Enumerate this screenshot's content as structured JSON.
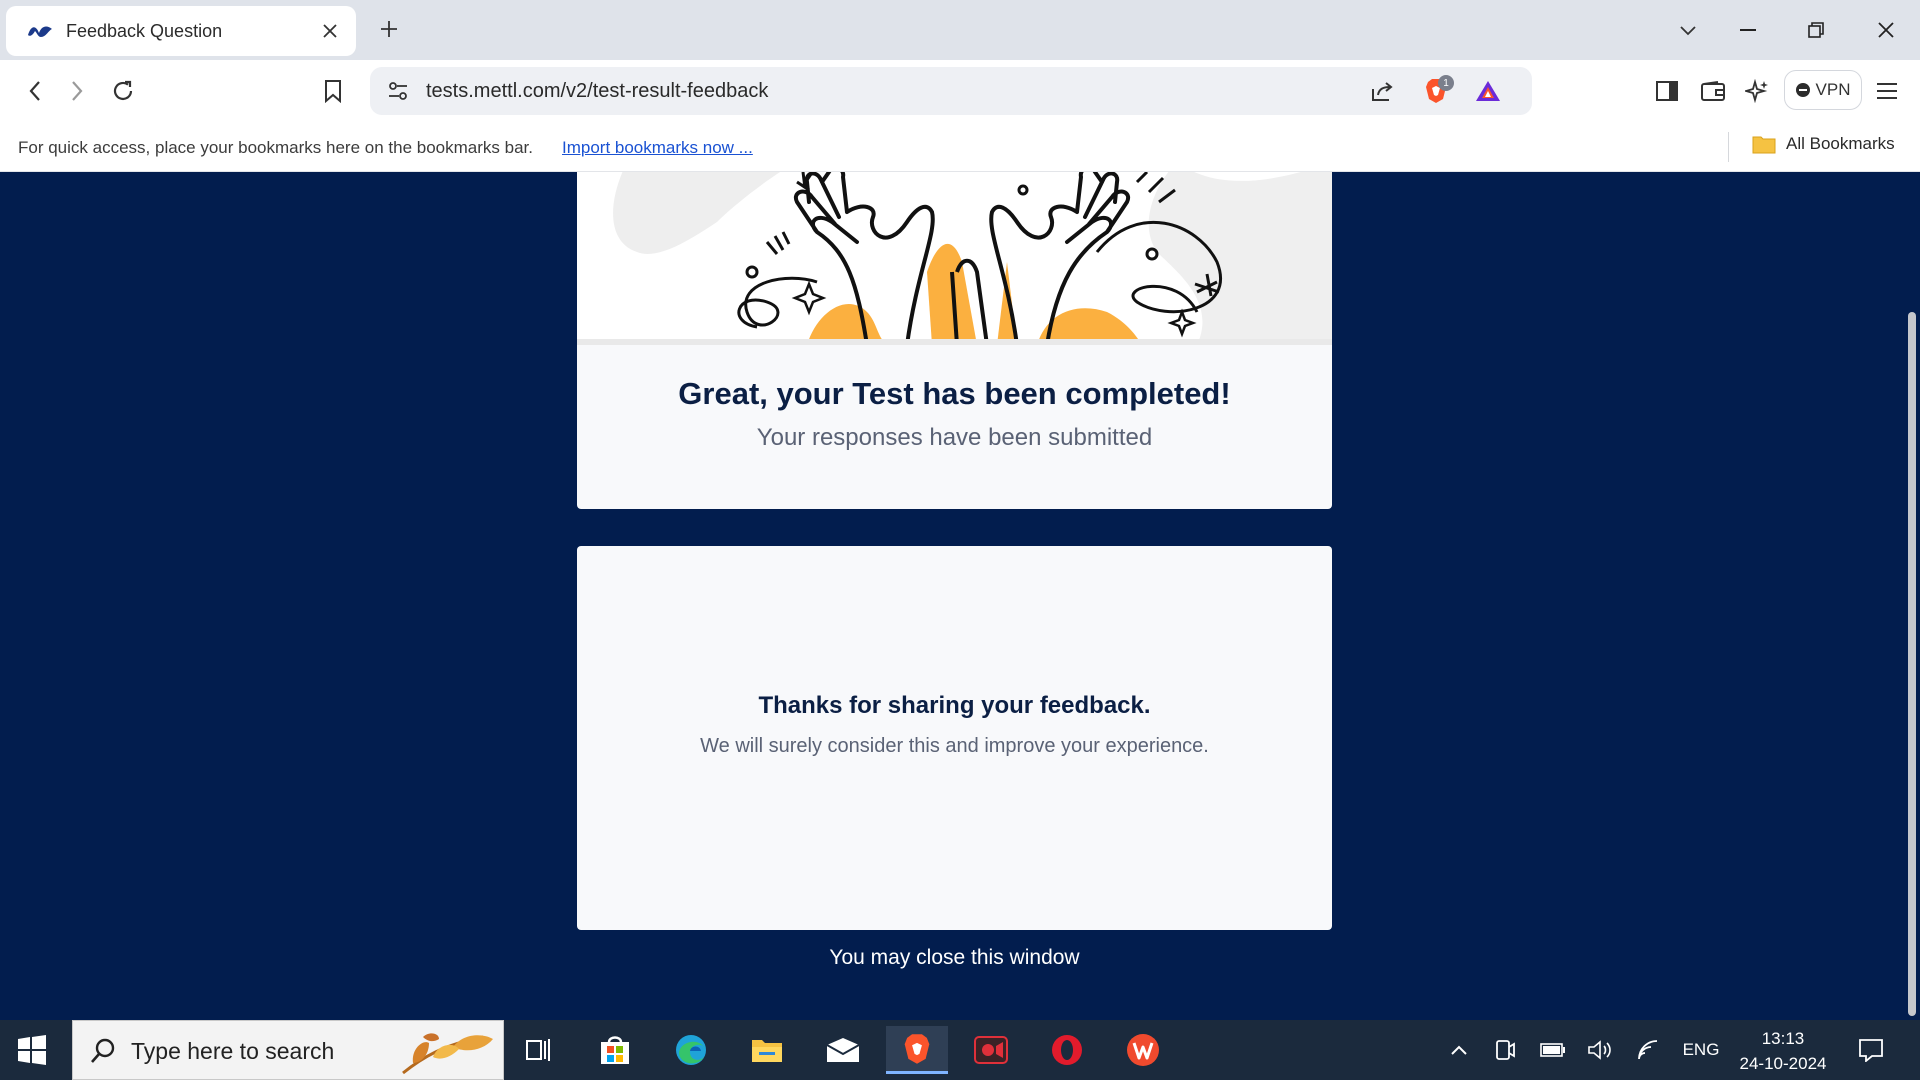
{
  "browser": {
    "tab_title": "Feedback Question",
    "url": "tests.mettl.com/v2/test-result-feedback",
    "shield_badge": "1",
    "vpn_label": "VPN"
  },
  "bookmarks_bar": {
    "hint": "For quick access, place your bookmarks here on the bookmarks bar.",
    "import_link": "Import bookmarks now ...",
    "all_bookmarks": "All Bookmarks"
  },
  "page": {
    "completion_title": "Great, your Test has been completed!",
    "completion_subtitle": "Your responses have been submitted",
    "feedback_title": "Thanks for sharing your feedback.",
    "feedback_subtitle": "We will surely consider this and improve your experience.",
    "close_message": "You may close this window"
  },
  "taskbar": {
    "search_placeholder": "Type here to search",
    "language": "ENG",
    "time": "13:13",
    "date": "24-10-2024"
  },
  "colors": {
    "page_background": "#021d4e",
    "card_background": "#f8f9fb",
    "accent_orange": "#fbb040",
    "title_navy": "#0b1f44"
  }
}
